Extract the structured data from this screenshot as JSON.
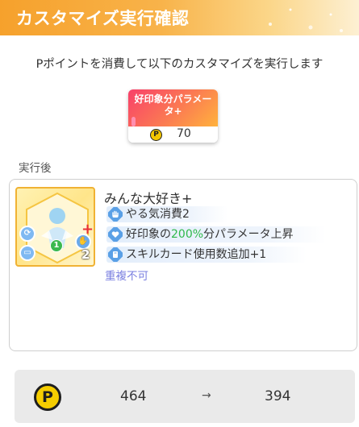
{
  "header": {
    "title": "カスタマイズ実行確認"
  },
  "message": "Pポイントを消費して以下のカスタマイズを実行します",
  "cost_card": {
    "label": "好印象分パラメータ+",
    "point_icon": "P",
    "cost": "70"
  },
  "after_label": "実行後",
  "card": {
    "name": "みんな大好き+",
    "thumb_level": "2",
    "thumb_badge": "1",
    "effects": [
      {
        "icon": "hand-icon",
        "text": "やる気消費2"
      },
      {
        "icon": "heart-icon",
        "prefix": "好印象の",
        "highlight": "200%",
        "suffix": "分パラメータ上昇"
      },
      {
        "icon": "card-icon",
        "text": "スキルカード使用数追加+1"
      }
    ],
    "note": "重複不可"
  },
  "footer": {
    "point_icon": "P",
    "before": "464",
    "arrow": "→",
    "after": "394"
  },
  "colors": {
    "header_orange": "#f6a12c",
    "card_pink": "#f8406a",
    "highlight_green": "#2fb84a",
    "note_purple": "#7a7fe0",
    "point_gold": "#f5cd00"
  }
}
